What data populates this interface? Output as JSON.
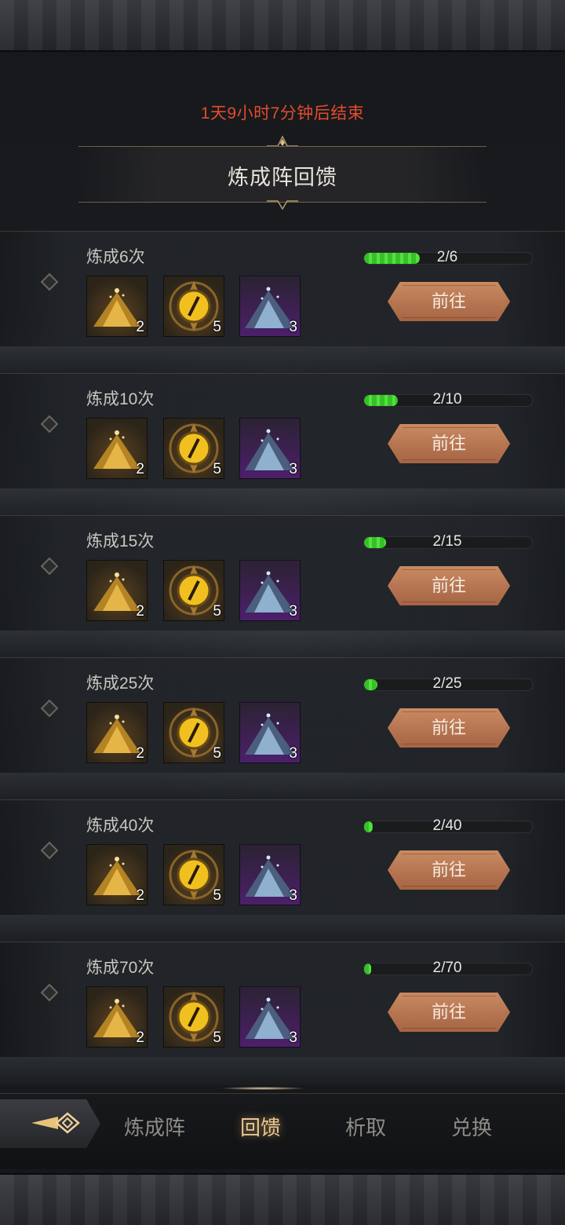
{
  "header": {
    "timer_text": "1天9小时7分钟后结束",
    "title": "炼成阵回馈"
  },
  "tiers": [
    {
      "label": "炼成6次",
      "progress_text": "2/6",
      "progress": 0.333,
      "go_label": "前往",
      "rewards": [
        {
          "icon": "gold-dust-pile-icon",
          "count": "2"
        },
        {
          "icon": "gold-orb-emblem-icon",
          "count": "5"
        },
        {
          "icon": "blue-crystal-pile-icon",
          "count": "3"
        }
      ]
    },
    {
      "label": "炼成10次",
      "progress_text": "2/10",
      "progress": 0.2,
      "go_label": "前往",
      "rewards": [
        {
          "icon": "gold-dust-pile-icon",
          "count": "2"
        },
        {
          "icon": "gold-orb-emblem-icon",
          "count": "5"
        },
        {
          "icon": "blue-crystal-pile-icon",
          "count": "3"
        }
      ]
    },
    {
      "label": "炼成15次",
      "progress_text": "2/15",
      "progress": 0.133,
      "go_label": "前往",
      "rewards": [
        {
          "icon": "gold-dust-pile-icon",
          "count": "2"
        },
        {
          "icon": "gold-orb-emblem-icon",
          "count": "5"
        },
        {
          "icon": "blue-crystal-pile-icon",
          "count": "3"
        }
      ]
    },
    {
      "label": "炼成25次",
      "progress_text": "2/25",
      "progress": 0.08,
      "go_label": "前往",
      "rewards": [
        {
          "icon": "gold-dust-pile-icon",
          "count": "2"
        },
        {
          "icon": "gold-orb-emblem-icon",
          "count": "5"
        },
        {
          "icon": "blue-crystal-pile-icon",
          "count": "3"
        }
      ]
    },
    {
      "label": "炼成40次",
      "progress_text": "2/40",
      "progress": 0.05,
      "go_label": "前往",
      "rewards": [
        {
          "icon": "gold-dust-pile-icon",
          "count": "2"
        },
        {
          "icon": "gold-orb-emblem-icon",
          "count": "5"
        },
        {
          "icon": "blue-crystal-pile-icon",
          "count": "3"
        }
      ]
    },
    {
      "label": "炼成70次",
      "progress_text": "2/70",
      "progress": 0.029,
      "go_label": "前往",
      "rewards": [
        {
          "icon": "gold-dust-pile-icon",
          "count": "2"
        },
        {
          "icon": "gold-orb-emblem-icon",
          "count": "5"
        },
        {
          "icon": "blue-crystal-pile-icon",
          "count": "3"
        }
      ]
    }
  ],
  "nav": {
    "back_icon": "back-arrow-diamond-icon",
    "tabs": [
      {
        "label": "炼成阵",
        "active": false
      },
      {
        "label": "回馈",
        "active": true
      },
      {
        "label": "析取",
        "active": false
      },
      {
        "label": "兑换",
        "active": false
      }
    ]
  },
  "colors": {
    "timer": "#e34b2f",
    "progress_fill": "#52e23c",
    "button": "#b8744f",
    "active_tab": "#e6c796"
  }
}
